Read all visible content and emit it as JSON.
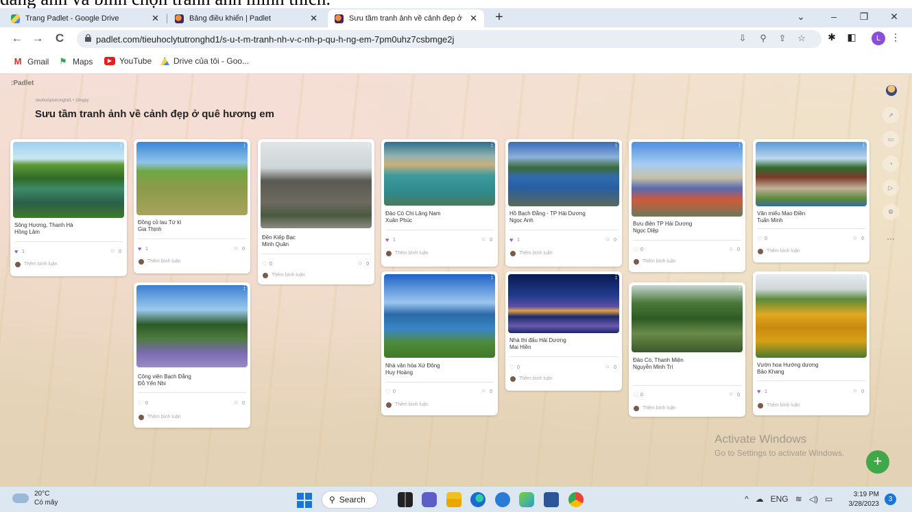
{
  "caption_top": "đăng ảnh và bình chọn tranh ảnh mình thích.",
  "browser": {
    "tabs": [
      {
        "title": "Trang Padlet - Google Drive",
        "icon": "google-drive-icon"
      },
      {
        "title": "Bảng điều khiển | Padlet",
        "icon": "padlet-icon"
      },
      {
        "title": "Sưu tầm tranh ảnh về cảnh đẹp ở",
        "icon": "padlet-icon"
      }
    ],
    "url": "padlet.com/tieuhoclytutronghd1/s-u-t-m-tranh-nh-v-c-nh-p-qu-h-ng-em-7pm0uhz7csbmge2j",
    "profile_initial": "L",
    "bookmarks": [
      {
        "label": "Gmail",
        "icon": "gmail-icon"
      },
      {
        "label": "Maps",
        "icon": "maps-icon"
      },
      {
        "label": "YouTube",
        "icon": "youtube-icon"
      },
      {
        "label": "Drive của tôi - Goo...",
        "icon": "google-drive-icon"
      }
    ]
  },
  "padlet": {
    "logo": ":Padlet",
    "meta": "tieuhoclytutronghd1 • 19ngày",
    "title": "Sưu tầm tranh ảnh về cảnh đẹp ở quê hương em",
    "add_comment": "Thêm bình luận",
    "cards": [
      {
        "title": "Sông Hương, Thanh Hà",
        "author": "Hồng Lâm",
        "likes": "1",
        "liked": true,
        "comments": "0"
      },
      {
        "title": "Đồng cỏ lau Tứ kì",
        "author": "Gia Thịnh",
        "likes": "1",
        "liked": true,
        "comments": "0"
      },
      {
        "title": "Công viên Bạch Đằng",
        "author": "Đỗ Yến Nhi",
        "likes": "0",
        "liked": false,
        "comments": "0"
      },
      {
        "title": "Đền Kiếp Bạc",
        "author": "Minh Quân",
        "likes": "0",
        "liked": false,
        "comments": "0"
      },
      {
        "title": "Đảo Cò Chi Lăng Nam",
        "author": "Xuân Phúc",
        "likes": "1",
        "liked": true,
        "comments": "0"
      },
      {
        "title": "Nhà văn hóa Xứ Đông",
        "author": "Huy Hoàng",
        "likes": "0",
        "liked": false,
        "comments": "0"
      },
      {
        "title": "Hồ Bạch Đằng - TP Hải Dương",
        "author": "Ngọc Anh",
        "likes": "1",
        "liked": true,
        "comments": "0"
      },
      {
        "title": "Nhà thi đấu Hải Dương",
        "author": "Mai Hiền",
        "likes": "0",
        "liked": false,
        "comments": "0"
      },
      {
        "title": "Bưu điện TP Hải Dương",
        "author": "Ngọc Diệp",
        "likes": "0",
        "liked": false,
        "comments": "0"
      },
      {
        "title": "Đảo Cò, Thanh Miện",
        "author": "Nguyễn Minh Trí",
        "likes": "0",
        "liked": false,
        "comments": "0"
      },
      {
        "title": "Văn miếu Mao Điền",
        "author": "Tuấn Minh",
        "likes": "0",
        "liked": false,
        "comments": "0"
      },
      {
        "title": "Vườn hoa Hướng dương",
        "author": "Bảo Khang",
        "likes": "1",
        "liked": true,
        "comments": "0"
      }
    ],
    "right_toolbar": [
      "share-icon",
      "slideshow-icon",
      "bell-icon",
      "play-icon",
      "settings-icon",
      "more-icon"
    ],
    "more_label": "···",
    "fab_label": "+"
  },
  "watermark": {
    "line1": "Activate Windows",
    "line2": "Go to Settings to activate Windows."
  },
  "taskbar": {
    "temperature": "20°C",
    "weather": "Có mây",
    "search": "Search",
    "language": "ENG",
    "time": "3:19 PM",
    "date": "3/28/2023",
    "notifications": "3"
  }
}
